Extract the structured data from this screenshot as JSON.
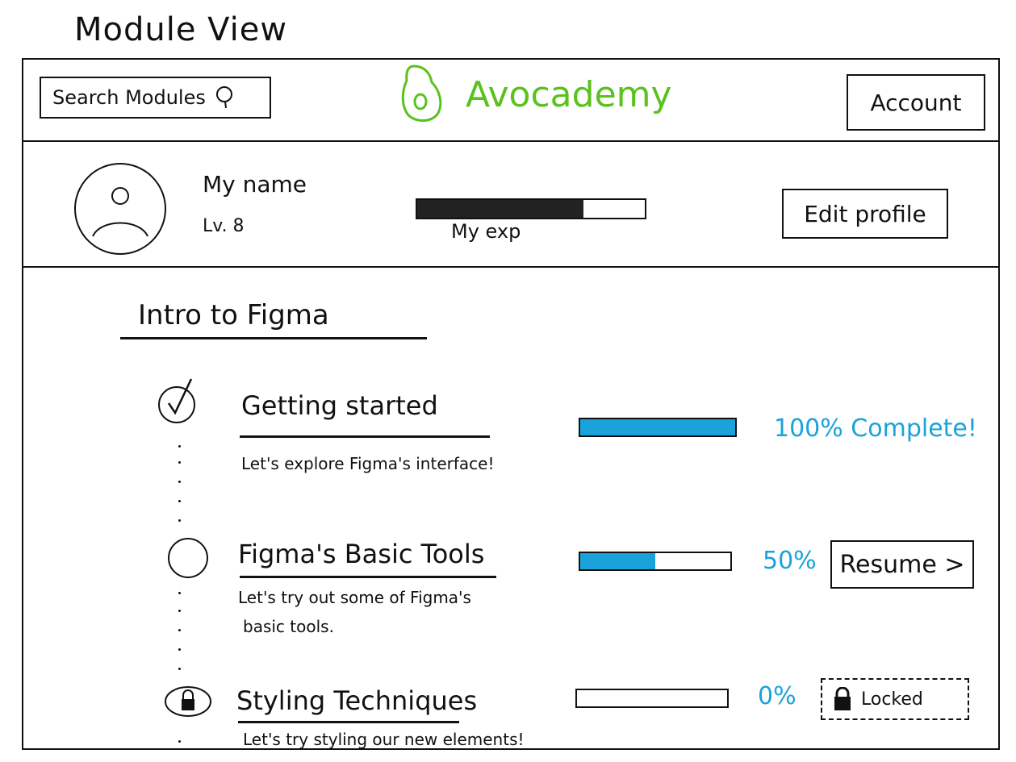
{
  "page": {
    "title": "Module View"
  },
  "header": {
    "search_label": "Search Modules",
    "brand_name": "Avocademy",
    "account_label": "Account"
  },
  "profile": {
    "name": "My name",
    "level": "Lv. 8",
    "exp_label": "My exp",
    "exp_progress": 0.73,
    "edit_label": "Edit profile"
  },
  "section": {
    "title": "Intro to Figma"
  },
  "modules": [
    {
      "title": "Getting started",
      "description": "Let's explore Figma's interface!",
      "progress": 1.0,
      "status_text": "100% Complete!",
      "state": "complete"
    },
    {
      "title": "Figma's Basic Tools",
      "description_line1": "Let's try out some of Figma's",
      "description_line2": "basic tools.",
      "progress": 0.5,
      "status_text": "50%",
      "action_label": "Resume >",
      "state": "in-progress"
    },
    {
      "title": "Styling Techniques",
      "description": "Let's try styling our new elements!",
      "progress": 0.0,
      "status_text": "0%",
      "action_label": "Locked",
      "state": "locked"
    }
  ],
  "colors": {
    "brand": "#5ac21c",
    "progress": "#1aa3da",
    "ink": "#111111"
  },
  "icons": {
    "search": "search-icon",
    "logo": "avocado-icon",
    "avatar": "user-avatar-icon",
    "complete": "check-circle-icon",
    "in_progress": "empty-circle-icon",
    "locked": "lock-icon"
  }
}
